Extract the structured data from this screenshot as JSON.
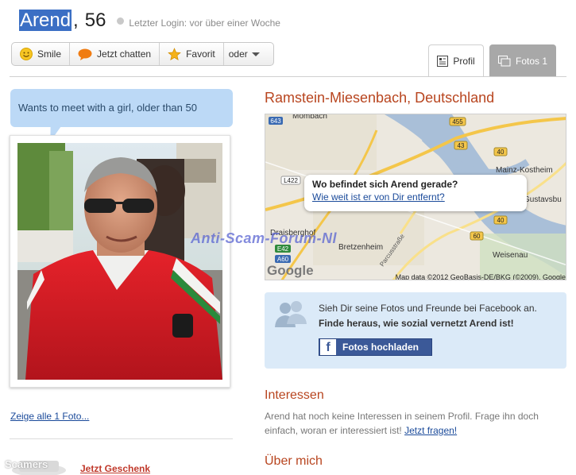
{
  "header": {
    "name": "Arend",
    "age_sep": ",",
    "age": "56",
    "last_login": "Letzter Login: vor über einer Woche"
  },
  "actions": {
    "smile": "Smile",
    "chat": "Jetzt chatten",
    "favorite": "Favorit",
    "more": "oder"
  },
  "tabs": {
    "profile": "Profil",
    "photos": "Fotos 1"
  },
  "status_bubble": "Wants to meet with a girl, older than 50",
  "left": {
    "show_all_photos": "Zeige alle 1 Foto...",
    "gift": "Jetzt Geschenk",
    "corner_watermark": "Scamers"
  },
  "location": {
    "title": "Ramstein-Miesenbach, Deutschland",
    "map_question": "Wo befindet sich Arend gerade?",
    "map_link": "Wie weit ist er von Dir entfernt?",
    "map_labels": [
      "Mombach",
      "Mainz-Kostheim",
      "Gustavsbu",
      "Draisberghof",
      "Bretzenheim",
      "Weisenau",
      "Parcusstraße"
    ],
    "road_badges": [
      "643",
      "455",
      "43",
      "40",
      "L422",
      "40",
      "60",
      "E42",
      "A60"
    ],
    "map_attribution": "Map data ©2012 GeoBasis-DE/BKG (©2009), Google",
    "map_logo": "Google"
  },
  "watermark": "Anti-Scam-Forum-Nl",
  "facebook": {
    "line1": "Sieh Dir seine Fotos und Freunde bei Facebook an.",
    "line2": "Finde heraus, wie sozial vernetzt Arend ist!",
    "button": "Fotos hochladen",
    "button_icon": "f"
  },
  "interests": {
    "title": "Interessen",
    "text": "Arend hat noch keine Interessen in seinem Profil. Frage ihn doch einfach, woran er interessiert ist!",
    "link": "Jetzt fragen!"
  },
  "about": {
    "title": "Über mich"
  },
  "colors": {
    "section_title": "#b8451f",
    "link": "#1a4a9a",
    "bubble": "#bcd9f6",
    "facebook": "#3b5998",
    "name_highlight": "#3b6fc4"
  }
}
